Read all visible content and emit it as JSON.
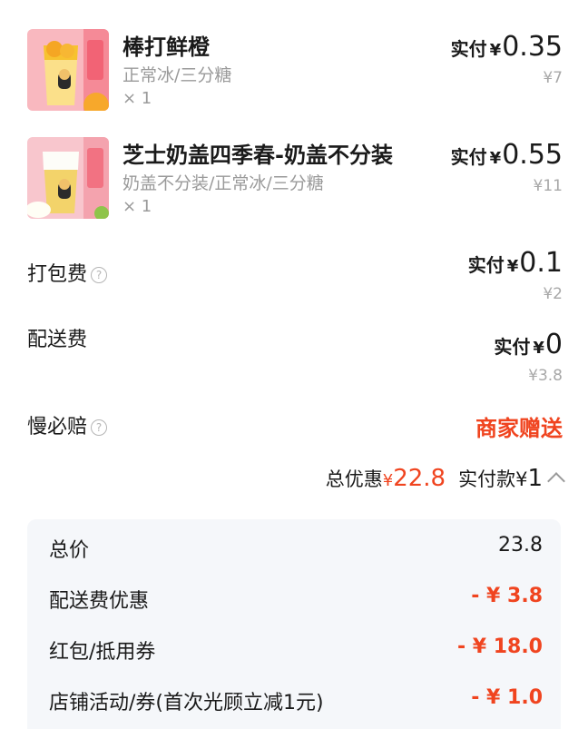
{
  "items": [
    {
      "name": "棒打鲜橙",
      "spec": "正常冰/三分糖",
      "qty": "× 1",
      "paid_label": "实付",
      "currency": "¥",
      "paid": "0.35",
      "original": "¥7",
      "thumb_icon": "orange-drink-thumbnail"
    },
    {
      "name": "芝士奶盖四季春-奶盖不分装",
      "spec": "奶盖不分装/正常冰/三分糖",
      "qty": "× 1",
      "paid_label": "实付",
      "currency": "¥",
      "paid": "0.55",
      "original": "¥11",
      "thumb_icon": "cheese-tea-thumbnail"
    }
  ],
  "fees": {
    "packing": {
      "label": "打包费",
      "paid_label": "实付",
      "currency": "¥",
      "paid": "0.1",
      "original": "¥2"
    },
    "delivery": {
      "label": "配送费",
      "paid_label": "实付",
      "currency": "¥",
      "paid": "0",
      "original": "¥3.8"
    },
    "late_comp": {
      "label": "慢必赔",
      "value": "商家赠送"
    }
  },
  "summary": {
    "discount_label": "总优惠",
    "discount_currency": "¥",
    "discount": "22.8",
    "pay_label": "实付款",
    "pay_currency": "¥",
    "pay": "1"
  },
  "breakdown": [
    {
      "label": "总价",
      "value": "23.8"
    },
    {
      "label": "配送费优惠",
      "value": "- ¥ 3.8"
    },
    {
      "label": "红包/抵用券",
      "value": "- ¥ 18.0"
    },
    {
      "label": "店铺活动/券(首次光顾立减1元)",
      "value": "- ¥ 1.0"
    }
  ],
  "colors": {
    "accent": "#f0441f",
    "muted": "#9a9a9a",
    "panel": "#f5f7fa"
  },
  "help_icon_glyph": "?"
}
